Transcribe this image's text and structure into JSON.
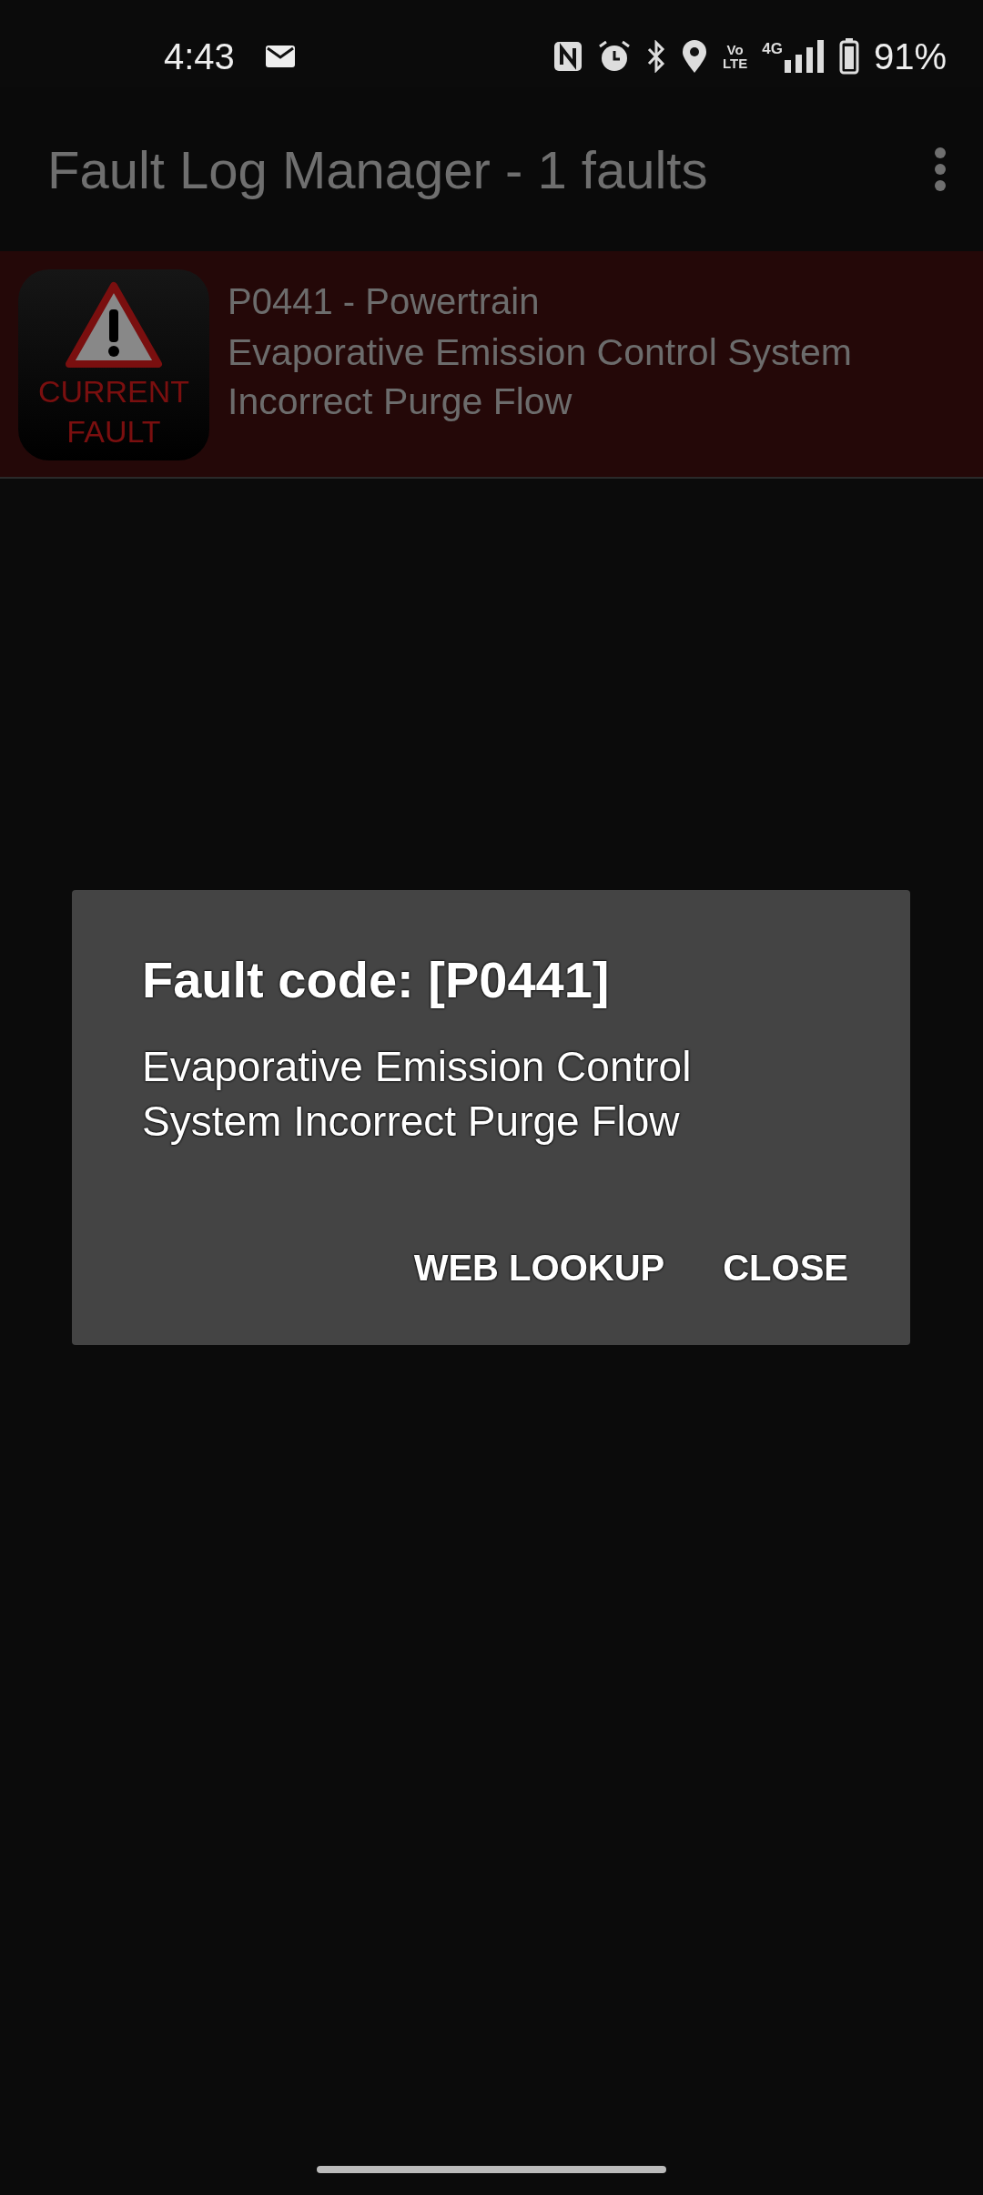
{
  "status_bar": {
    "time": "4:43",
    "volte": [
      "Vo",
      "LTE"
    ],
    "network": "4G",
    "battery": "91%"
  },
  "app_bar": {
    "title": "Fault Log Manager - 1 faults"
  },
  "faults": [
    {
      "badge": "CURRENT FAULT",
      "title": "P0441 - Powertrain",
      "description": "Evaporative Emission Control System Incorrect Purge Flow"
    }
  ],
  "dialog": {
    "title": "Fault code: [P0441]",
    "message": "Evaporative Emission Control System Incorrect Purge Flow",
    "buttons": [
      "WEB LOOKUP",
      "CLOSE"
    ]
  }
}
